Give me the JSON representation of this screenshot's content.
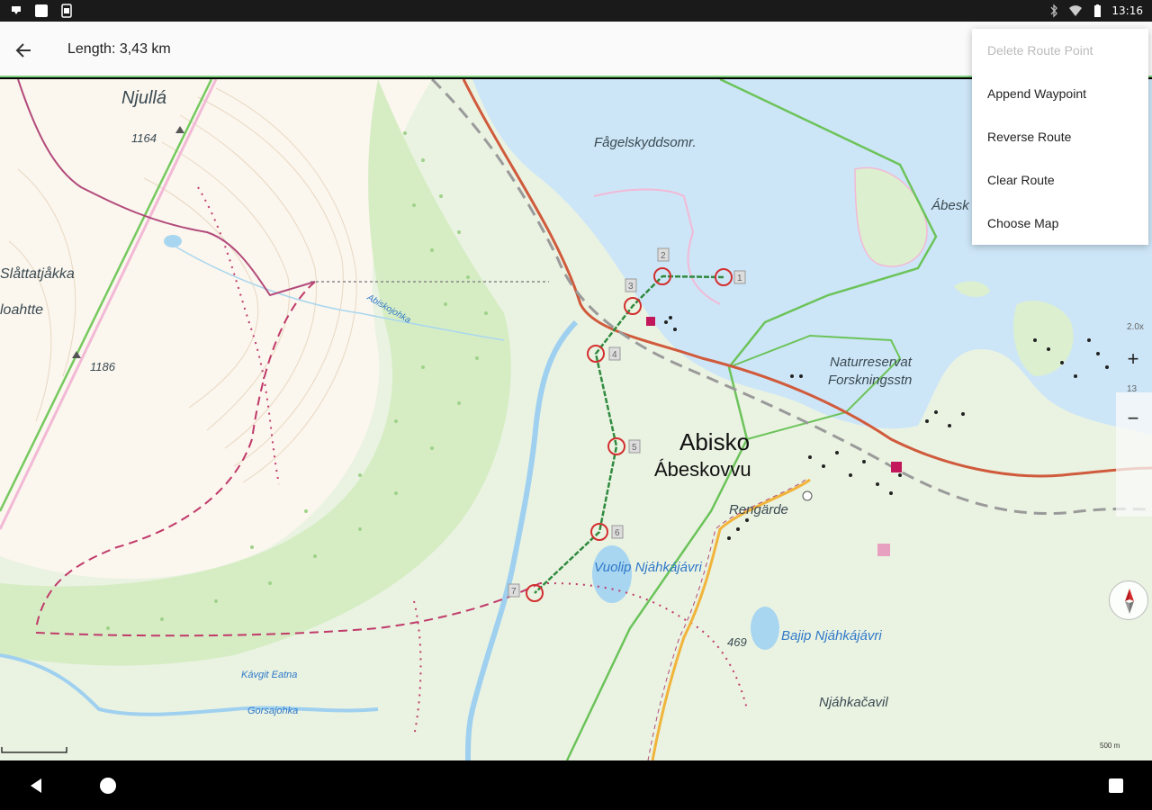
{
  "status_bar": {
    "time": "13:16",
    "left_icons": [
      "download-icon",
      "notification-icon",
      "battery-saver-icon"
    ],
    "right_icons": [
      "bluetooth-icon",
      "wifi-icon",
      "battery-icon"
    ]
  },
  "app_bar": {
    "title": "Length: 3,43 km",
    "back_icon": "arrow-back-icon"
  },
  "menu": {
    "items": [
      {
        "label": "Delete Route Point",
        "enabled": false
      },
      {
        "label": "Append Waypoint",
        "enabled": true
      },
      {
        "label": "Reverse Route",
        "enabled": true
      },
      {
        "label": "Clear Route",
        "enabled": true
      },
      {
        "label": "Choose Map",
        "enabled": true
      }
    ]
  },
  "map": {
    "labels": {
      "njulla": "Njullá",
      "elev_1164": "1164",
      "slattatjakka": "Slåttatjåkka",
      "loahtte": "loahtte",
      "elev_1186": "1186",
      "fagelskydd": "Fågelskyddsomr.",
      "abesk": "Ábesk",
      "naturreservat": "Naturreservat",
      "forskningsstn": "Forskningsstn",
      "abisko": "Abisko",
      "abeskovvu": "Ábeskovvu",
      "rengarde": "Rengärde",
      "vuolip": "Vuolip Njáhkájávri",
      "bajip": "Bajip Njáhkájávri",
      "elev_469": "469",
      "njahkacavil": "Njáhkačavil",
      "kaitjeatna": "Kávgit Eatna",
      "gorsaijohka": "Gorsajohka",
      "abiskojokka": "Abiskojohka"
    },
    "route_points": [
      "1",
      "2",
      "3",
      "4",
      "5",
      "6",
      "7"
    ],
    "route_color": "#2f8a3e",
    "point_color": "#d32f2f",
    "zoom": {
      "scale_label": "2.0x",
      "zoom_in": "+",
      "zoom_out": "−",
      "level": "13"
    },
    "scale_bar_label": "500 m",
    "compass_icon": "compass-icon"
  },
  "nav_bar": {
    "back_icon": "nav-back-icon",
    "home_icon": "nav-home-icon",
    "recents_icon": "nav-recents-icon"
  }
}
